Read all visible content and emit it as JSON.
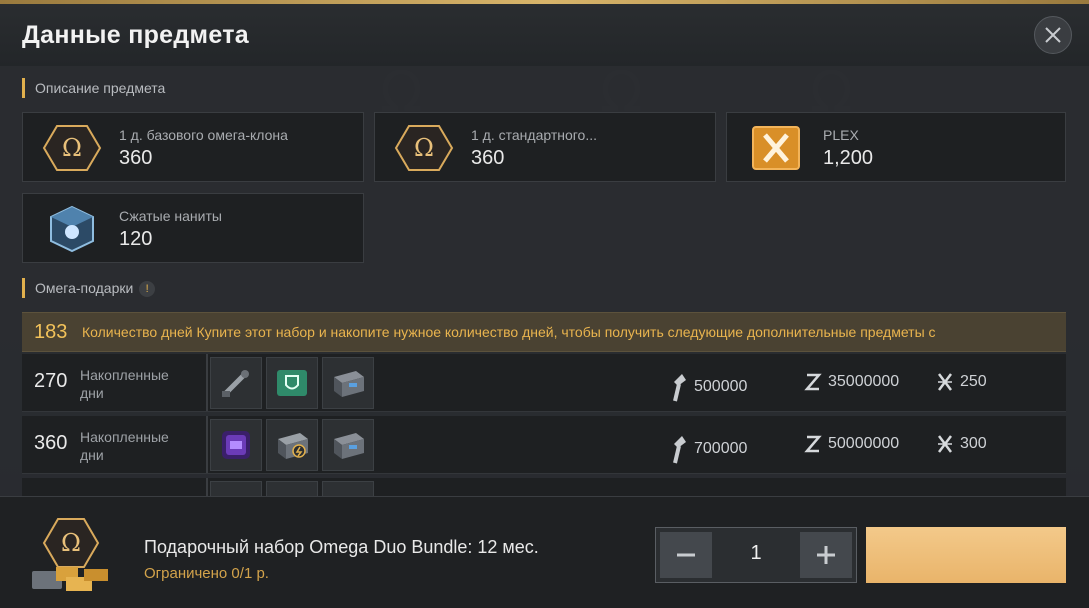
{
  "header": {
    "title": "Данные предмета"
  },
  "description": {
    "label": "Описание предмета",
    "items": [
      {
        "icon": "omega-hex-icon",
        "name": "1 д. базового омега-клона",
        "qty": "360"
      },
      {
        "icon": "omega-hex-icon",
        "name": "1 д. стандартного...",
        "qty": "360"
      },
      {
        "icon": "plex-icon",
        "name": "PLEX",
        "qty": "1,200"
      },
      {
        "icon": "nanite-cube-icon",
        "name": "Сжатые наниты",
        "qty": "120"
      }
    ]
  },
  "gifts": {
    "label": "Омега-подарки",
    "info_icon": "!",
    "banner": {
      "days": "183",
      "text": "Количество дней Купите этот набор и накопите нужное количество дней, чтобы получить следующие дополнительные предметы с"
    },
    "rows": [
      {
        "days": "270",
        "days_label": "Накопленные дни",
        "slots": [
          "turret-item-icon",
          "green-shield-icon",
          "crate-icon"
        ],
        "resources": [
          {
            "icon": "torch-icon",
            "value": "500000"
          },
          {
            "icon": "isk-icon",
            "value": "35000000"
          },
          {
            "icon": "plex-small-icon",
            "value": "250"
          }
        ]
      },
      {
        "days": "360",
        "days_label": "Накопленные дни",
        "slots": [
          "purple-skin-icon",
          "booster-crate-icon",
          "crate-icon"
        ],
        "resources": [
          {
            "icon": "torch-icon",
            "value": "700000"
          },
          {
            "icon": "isk-icon",
            "value": "50000000"
          },
          {
            "icon": "plex-small-icon",
            "value": "300"
          }
        ]
      }
    ]
  },
  "footer": {
    "bundle_name": "Подарочный набор Omega Duo Bundle: 12 мес.",
    "limit": "Ограничено 0/1 р.",
    "quantity": "1",
    "minus": "−",
    "plus": "+"
  },
  "colors": {
    "accent_gold": "#e1b04d",
    "banner_text": "#e9b44e",
    "buy_button": "#efc07d"
  }
}
